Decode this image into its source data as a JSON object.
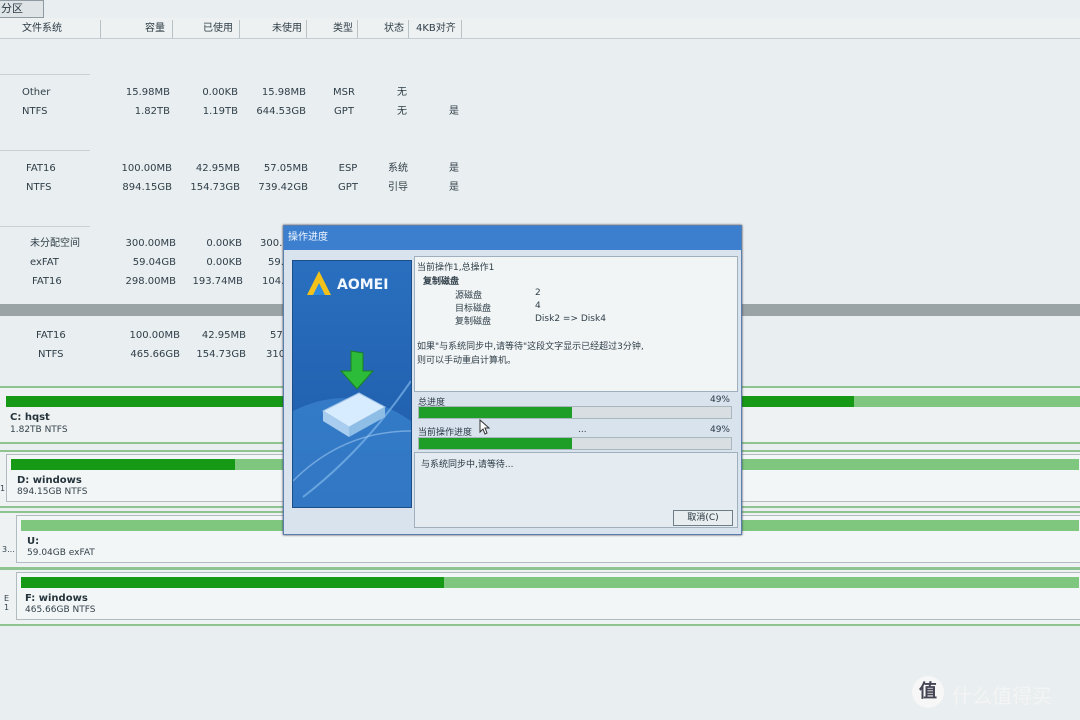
{
  "toolbar": {
    "partition_label": "分区"
  },
  "table": {
    "headers": [
      "文件系统",
      "容量",
      "已使用",
      "未使用",
      "类型",
      "状态",
      "4KB对齐"
    ],
    "rows": [
      [
        "Other",
        "15.98MB",
        "0.00KB",
        "15.98MB",
        "MSR",
        "无",
        ""
      ],
      [
        "NTFS",
        "1.82TB",
        "1.19TB",
        "644.53GB",
        "GPT",
        "无",
        "是"
      ],
      [
        "FAT16",
        "100.00MB",
        "42.95MB",
        "57.05MB",
        "ESP",
        "系统",
        "是"
      ],
      [
        "NTFS",
        "894.15GB",
        "154.73GB",
        "739.42GB",
        "GPT",
        "引导",
        "是"
      ],
      [
        "未分配空间",
        "300.00MB",
        "0.00KB",
        "300.",
        "",
        "",
        ""
      ],
      [
        "exFAT",
        "59.04GB",
        "0.00KB",
        "59.",
        "",
        "",
        ""
      ],
      [
        "FAT16",
        "298.00MB",
        "193.74MB",
        "104.",
        "",
        "",
        ""
      ],
      [
        "FAT16",
        "100.00MB",
        "42.95MB",
        "57.",
        "",
        "",
        ""
      ],
      [
        "NTFS",
        "465.66GB",
        "154.73GB",
        "310.",
        "",
        "",
        ""
      ]
    ]
  },
  "disks": [
    {
      "name": "C: hqst",
      "detail": "1.82TB NTFS",
      "left_label": "",
      "used_fraction": 0.79
    },
    {
      "name": "D: windows",
      "detail": "894.15GB NTFS",
      "left_label": "1",
      "used_fraction": 0.21
    },
    {
      "name": "U:",
      "detail": "59.04GB exFAT",
      "left_label": "3...",
      "used_fraction": 0.0
    },
    {
      "name": "F: windows",
      "detail": "465.66GB NTFS",
      "left_label": "E 1",
      "used_fraction": 0.4
    }
  ],
  "dialog": {
    "title": "操作进度",
    "brand": "AOMEI",
    "info": {
      "line1": "当前操作1,总操作1",
      "op": "复制磁盘",
      "src_label": "源磁盘",
      "src_val": "2",
      "dst_label": "目标磁盘",
      "dst_val": "4",
      "copy_label": "复制磁盘",
      "copy_val": "Disk2 => Disk4",
      "msg1": "如果\"与系统同步中,请等待\"这段文字显示已经超过3分钟,",
      "msg2": "则可以手动重启计算机。"
    },
    "total_label": "总进度",
    "total_pct": "49%",
    "total_value": 0.49,
    "current_label": "当前操作进度",
    "current_pct": "49%",
    "current_value": 0.49,
    "current_extra": "...",
    "status": "与系统同步中,请等待...",
    "cancel_label": "取消(C)"
  },
  "watermark": {
    "text": "什么值得买",
    "icon": "值"
  },
  "colors": {
    "accent": "#3d7fcf",
    "progress": "#1e9e26",
    "disk_used": "#169a16",
    "disk_free": "#7fc77f"
  }
}
